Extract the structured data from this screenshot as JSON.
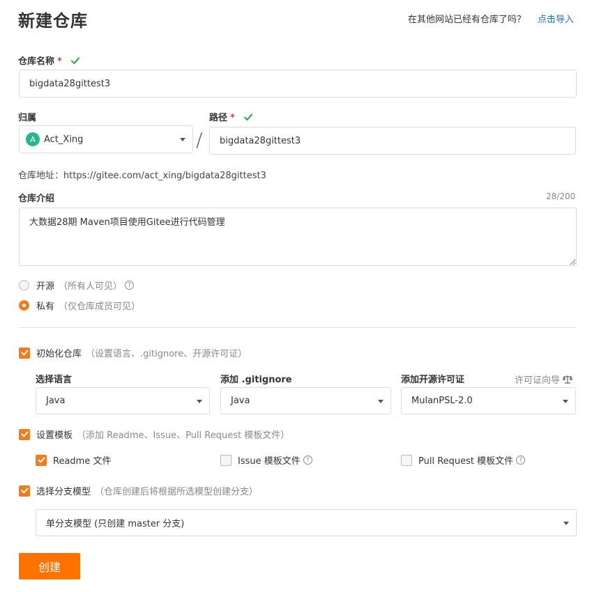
{
  "header": {
    "title": "新建仓库",
    "import_hint": "在其他网站已经有仓库了吗？",
    "import_link": "点击导入"
  },
  "repo_name": {
    "label": "仓库名称",
    "required_mark": "*",
    "value": "bigdata28gittest3"
  },
  "owner": {
    "label": "归属",
    "avatar_letter": "A",
    "value": "Act_Xing"
  },
  "separator": "/",
  "path": {
    "label": "路径",
    "required_mark": "*",
    "value": "bigdata28gittest3"
  },
  "repo_address": "仓库地址：https://gitee.com/act_xing/bigdata28gittest3",
  "description": {
    "label": "仓库介绍",
    "counter": "28/200",
    "value": "大数据28期 Maven项目使用Gitee进行代码管理"
  },
  "visibility": {
    "public_label": "开源",
    "public_hint": "（所有人可见）",
    "private_label": "私有",
    "private_hint": "（仅仓库成员可见）",
    "selected": "private"
  },
  "init_repo": {
    "label": "初始化仓库",
    "hint": "（设置语言、.gitignore、开源许可证）",
    "checked": true,
    "language_label": "选择语言",
    "language_value": "Java",
    "gitignore_label": "添加 .gitignore",
    "gitignore_value": "Java",
    "license_label": "添加开源许可证",
    "license_guide": "许可证向导",
    "license_value": "MulanPSL-2.0"
  },
  "template": {
    "label": "设置模板",
    "hint": "（添加 Readme、Issue、Pull Request 模板文件）",
    "checked": true,
    "readme_label": "Readme 文件",
    "readme_checked": true,
    "issue_label": "Issue 模板文件",
    "issue_checked": false,
    "pr_label": "Pull Request 模板文件",
    "pr_checked": false
  },
  "branch_model": {
    "label": "选择分支模型",
    "hint": "（仓库创建后将根据所选模型创建分支）",
    "checked": true,
    "value": "单分支模型 (只创建 master 分支)"
  },
  "submit": {
    "label": "创建"
  },
  "colors": {
    "accent": "#f27c1d",
    "button": "#fe7300",
    "link": "#1f6fbf",
    "success": "#3aa757"
  }
}
